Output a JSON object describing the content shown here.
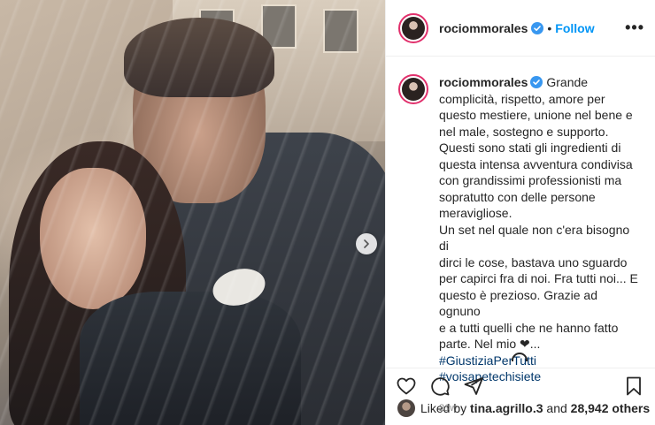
{
  "post": {
    "username": "rociommorales",
    "separator": "•",
    "follow_label": "Follow",
    "more_label": "•••"
  },
  "caption": {
    "username": "rociommorales",
    "lines": [
      "Grande",
      "complicità, rispetto, amore per",
      "questo mestiere, unione nel bene e",
      "nel male, sostegno e supporto.",
      "Questi sono stati gli ingredienti di",
      "questa intensa avventura condivisa",
      "con grandissimi professionisti ma",
      "sopratutto con delle persone",
      "meravigliose.",
      "Un set nel quale non c'era bisogno di",
      "dirci le cose, bastava uno sguardo",
      "per capirci fra di noi. Fra tutti noi... E",
      "questo è prezioso. Grazie ad ognuno",
      "e a tutti quelli che ne hanno fatto",
      "parte. Nel mio ❤..."
    ],
    "hashtag1": "#GiustiziaPerTutti",
    "hashtag2": "#voisapetechisiete",
    "time": "21w"
  },
  "likes": {
    "prefix": "Liked by",
    "user": "tina.agrillo.3",
    "middle": "and",
    "count": "28,942 others"
  },
  "colors": {
    "link": "#0095f6",
    "hashtag": "#00376b",
    "story_ring": "#e1306c",
    "muted": "#8e8e8e"
  },
  "icons": [
    "verified-badge-icon",
    "next-arrow-icon",
    "heart-icon",
    "comment-icon",
    "share-icon",
    "bookmark-icon",
    "loading-spinner-icon"
  ]
}
